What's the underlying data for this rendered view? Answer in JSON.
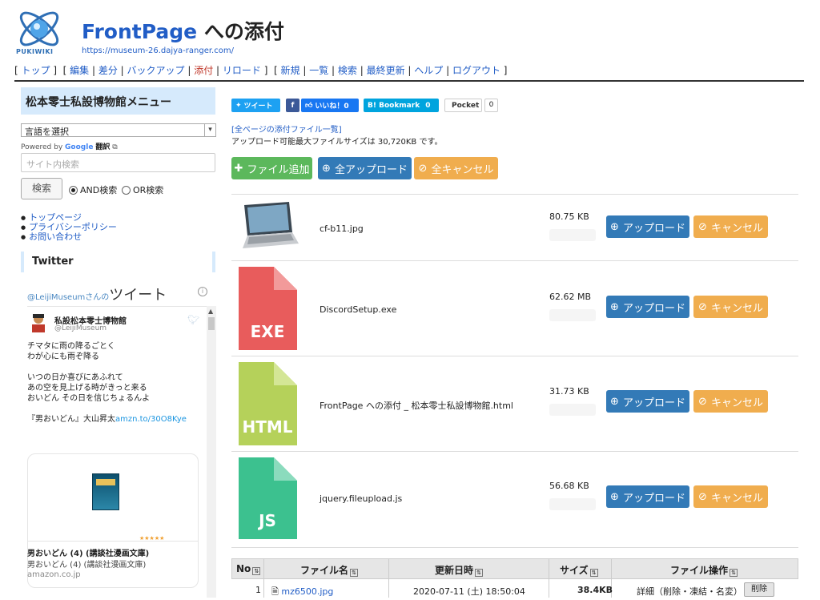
{
  "header": {
    "title_brand": "FrontPage",
    "title_rest": " への添付",
    "url": "https://museum-26.dajya-ranger.com/",
    "logo_text": "PUKIWIKI"
  },
  "nav": {
    "group1": [
      "トップ"
    ],
    "group2": [
      "編集",
      "差分",
      "バックアップ",
      "添付",
      "リロード"
    ],
    "group3": [
      "新規",
      "一覧",
      "検索",
      "最終更新",
      "ヘルプ",
      "ログアウト"
    ]
  },
  "sidebar": {
    "menu_title": "松本零士私設博物館メニュー",
    "lang_select": "言語を選択",
    "powered_by": "Powered by",
    "google": "Google",
    "translate": "翻訳",
    "search_placeholder": "サイト内検索",
    "search_button": "検索",
    "radio_and": "AND検索",
    "radio_or": "OR検索",
    "links": [
      "トップページ",
      "プライバシーポリシー",
      "お問い合わせ"
    ],
    "twitter_heading": "Twitter"
  },
  "twitter": {
    "title_handle": "@LeijiMuseumさんの",
    "title_big": "ツイート",
    "account_name": "私設松本零士博物館",
    "account_handle": "@LeijiMuseum",
    "tweet_lines": "チマタに雨の降るごとく\nわが心にも雨ぞ降る\n\nいつの日か喜びにあふれて\nあの空を見上げる時がきっと来る\nおいどん その日を信じちょるんよ",
    "tweet_source": "『男おいどん』大山昇太",
    "tweet_link": "amzn.to/30O8Kye",
    "card_title": "男おいどん (4) (講談社漫画文庫)",
    "card_sub": "男おいどん (4) (講談社漫画文庫)",
    "card_src": "amazon.co.jp",
    "stars": "★★★★★"
  },
  "share": {
    "tweet": "ツイート",
    "like": "いいね！0",
    "bookmark": "B! Bookmark",
    "bookmark_count": "0",
    "pocket": "Pocket",
    "pocket_count": "0"
  },
  "upload": {
    "attach_list_link": "[全ページの添付ファイル一覧]",
    "max_size": "アップロード可能最大ファイルサイズは 30,720KB です。",
    "add_file": "ファイル追加",
    "upload_all": "全アップロード",
    "cancel_all": "全キャンセル",
    "upload_label": "アップロード",
    "cancel_label": "キャンセル",
    "files": [
      {
        "name": "cf-b11.jpg",
        "size": "80.75 KB",
        "icon": "image-thumbnail"
      },
      {
        "name": "DiscordSetup.exe",
        "size": "62.62 MB",
        "icon": "exe-file-icon",
        "ext": "EXE",
        "color": "#e85c5c"
      },
      {
        "name": "FrontPage への添付 _ 松本零士私設博物館.html",
        "size": "31.73 KB",
        "icon": "html-file-icon",
        "ext": "HTML",
        "color": "#b5d15a"
      },
      {
        "name": "jquery.fileupload.js",
        "size": "56.68 KB",
        "icon": "js-file-icon",
        "ext": "JS",
        "color": "#3cc18f"
      }
    ]
  },
  "table": {
    "headers": [
      "No",
      "ファイル名",
      "更新日時",
      "サイズ",
      "ファイル操作"
    ],
    "rows": [
      {
        "no": "1",
        "name": "mz6500.jpg",
        "date": "2020-07-11 (土) 18:50:04",
        "size": "38.4KB",
        "ops": "詳細（削除・凍結・名変）",
        "delete": "削除"
      }
    ]
  }
}
